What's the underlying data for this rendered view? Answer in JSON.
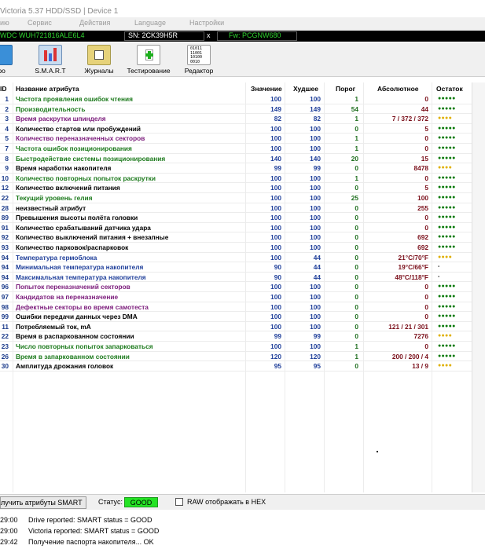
{
  "window": {
    "title": "Victoria 5.37 HDD/SSD | Device 1"
  },
  "menu": {
    "items": [
      "ию",
      "Сервис",
      "Действия",
      "Language",
      "Настройки"
    ]
  },
  "device": {
    "model": "WDC  WUH721816ALE6L4",
    "serial": "SN: 2CK39H5R",
    "close": "x",
    "firmware": "Fw: PCGNW680"
  },
  "toolbar": {
    "buttons": [
      {
        "label": "фо"
      },
      {
        "label": "S.M.A.R.T"
      },
      {
        "label": "Журналы"
      },
      {
        "label": "Тестирование"
      },
      {
        "label": "Редактор"
      }
    ]
  },
  "table": {
    "headers": {
      "id": "ID",
      "name": "Название атрибута",
      "value": "Значение",
      "worst": "Худшее",
      "threshold": "Порог",
      "raw": "Абсолютное",
      "remain": "Остаток"
    },
    "rows": [
      {
        "id": "1",
        "name": "Частота проявления ошибок чтения",
        "nc": "#1d7a1d",
        "v": "100",
        "w": "100",
        "t": "1",
        "a": "0",
        "r": "●●●●●",
        "rc": "#0a7a0a"
      },
      {
        "id": "2",
        "name": "Производительность",
        "nc": "#1d7a1d",
        "v": "149",
        "w": "149",
        "t": "54",
        "a": "44",
        "r": "●●●●●",
        "rc": "#0a7a0a"
      },
      {
        "id": "3",
        "name": "Время раскрутки шпинделя",
        "nc": "#7a1a7a",
        "v": "82",
        "w": "82",
        "t": "1",
        "a": "7 / 372 / 372",
        "r": "●●●●",
        "rc": "#e0b000"
      },
      {
        "id": "4",
        "name": "Количество стартов или пробуждений",
        "nc": "#000",
        "v": "100",
        "w": "100",
        "t": "0",
        "a": "5",
        "r": "●●●●●",
        "rc": "#0a7a0a"
      },
      {
        "id": "5",
        "name": "Количество переназначенных секторов",
        "nc": "#7a1a7a",
        "v": "100",
        "w": "100",
        "t": "1",
        "a": "0",
        "r": "●●●●●",
        "rc": "#0a7a0a"
      },
      {
        "id": "7",
        "name": "Частота ошибок позиционирования",
        "nc": "#1d7a1d",
        "v": "100",
        "w": "100",
        "t": "1",
        "a": "0",
        "r": "●●●●●",
        "rc": "#0a7a0a"
      },
      {
        "id": "8",
        "name": "Быстродействие системы позиционирования",
        "nc": "#1d7a1d",
        "v": "140",
        "w": "140",
        "t": "20",
        "a": "15",
        "r": "●●●●●",
        "rc": "#0a7a0a"
      },
      {
        "id": "9",
        "name": "Время наработки накопителя",
        "nc": "#000",
        "v": "99",
        "w": "99",
        "t": "0",
        "a": "8478",
        "r": "●●●●",
        "rc": "#e0b000"
      },
      {
        "id": "10",
        "name": "Количество повторных попыток раскрутки",
        "nc": "#1d7a1d",
        "v": "100",
        "w": "100",
        "t": "1",
        "a": "0",
        "r": "●●●●●",
        "rc": "#0a7a0a"
      },
      {
        "id": "12",
        "name": "Количество включений питания",
        "nc": "#000",
        "v": "100",
        "w": "100",
        "t": "0",
        "a": "5",
        "r": "●●●●●",
        "rc": "#0a7a0a"
      },
      {
        "id": "22",
        "name": "Текущий уровень гелия",
        "nc": "#1d7a1d",
        "v": "100",
        "w": "100",
        "t": "25",
        "a": "100",
        "r": "●●●●●",
        "rc": "#0a7a0a"
      },
      {
        "id": "28",
        "name": "неизвестный атрибут",
        "nc": "#000",
        "v": "100",
        "w": "100",
        "t": "0",
        "a": "255",
        "r": "●●●●●",
        "rc": "#0a7a0a"
      },
      {
        "id": "89",
        "name": "Превышения высоты полёта головки",
        "nc": "#000",
        "v": "100",
        "w": "100",
        "t": "0",
        "a": "0",
        "r": "●●●●●",
        "rc": "#0a7a0a"
      },
      {
        "id": "91",
        "name": "Количество срабатываний датчика удара",
        "nc": "#000",
        "v": "100",
        "w": "100",
        "t": "0",
        "a": "0",
        "r": "●●●●●",
        "rc": "#0a7a0a"
      },
      {
        "id": "92",
        "name": "Количество выключений питания + внезапные",
        "nc": "#000",
        "v": "100",
        "w": "100",
        "t": "0",
        "a": "692",
        "r": "●●●●●",
        "rc": "#0a7a0a"
      },
      {
        "id": "93",
        "name": "Количество парковок/распарковок",
        "nc": "#000",
        "v": "100",
        "w": "100",
        "t": "0",
        "a": "692",
        "r": "●●●●●",
        "rc": "#0a7a0a"
      },
      {
        "id": "94",
        "name": "Температура гермоблока",
        "nc": "#1f3f9a",
        "v": "100",
        "w": "44",
        "t": "0",
        "a": "21°C/70°F",
        "r": "●●●●",
        "rc": "#e0b000"
      },
      {
        "id": "94",
        "name": "Минимальная температура накопителя",
        "nc": "#1f3f9a",
        "v": "90",
        "w": "44",
        "t": "0",
        "a": "19°C/66°F",
        "r": "-",
        "rc": "#000"
      },
      {
        "id": "94",
        "name": "Максимальная температура накопителя",
        "nc": "#1f3f9a",
        "v": "90",
        "w": "44",
        "t": "0",
        "a": "48°C/118°F",
        "r": "-",
        "rc": "#000"
      },
      {
        "id": "96",
        "name": "Попыток переназначений секторов",
        "nc": "#7a1a7a",
        "v": "100",
        "w": "100",
        "t": "0",
        "a": "0",
        "r": "●●●●●",
        "rc": "#0a7a0a"
      },
      {
        "id": "97",
        "name": "Кандидатов на переназначение",
        "nc": "#7a1a7a",
        "v": "100",
        "w": "100",
        "t": "0",
        "a": "0",
        "r": "●●●●●",
        "rc": "#0a7a0a"
      },
      {
        "id": "98",
        "name": "Дефектные секторы во время самотеста",
        "nc": "#7a1a7a",
        "v": "100",
        "w": "100",
        "t": "0",
        "a": "0",
        "r": "●●●●●",
        "rc": "#0a7a0a"
      },
      {
        "id": "99",
        "name": "Ошибки передачи данных через DMA",
        "nc": "#000",
        "v": "100",
        "w": "100",
        "t": "0",
        "a": "0",
        "r": "●●●●●",
        "rc": "#0a7a0a"
      },
      {
        "id": "11",
        "name": "Потребляемый ток, mA",
        "nc": "#000",
        "v": "100",
        "w": "100",
        "t": "0",
        "a": "121 / 21 / 301",
        "r": "●●●●●",
        "rc": "#0a7a0a"
      },
      {
        "id": "22",
        "name": "Время в распаркованном состоянии",
        "nc": "#000",
        "v": "99",
        "w": "99",
        "t": "0",
        "a": "7276",
        "r": "●●●●",
        "rc": "#e0b000"
      },
      {
        "id": "23",
        "name": "Число повторных попыток запарковаться",
        "nc": "#1d7a1d",
        "v": "100",
        "w": "100",
        "t": "1",
        "a": "0",
        "r": "●●●●●",
        "rc": "#0a7a0a"
      },
      {
        "id": "26",
        "name": "Время в запаркованном состоянии",
        "nc": "#1d7a1d",
        "v": "120",
        "w": "120",
        "t": "1",
        "a": "200 / 200 / 4",
        "r": "●●●●●",
        "rc": "#0a7a0a"
      },
      {
        "id": "30",
        "name": "Амплитуда дрожания головок",
        "nc": "#000",
        "v": "95",
        "w": "95",
        "t": "0",
        "a": "13 / 9",
        "r": "●●●●",
        "rc": "#e0b000"
      }
    ]
  },
  "status": {
    "get_button": "лучить атрибуты SMART",
    "status_label": "Статус:",
    "status_value": "GOOD",
    "raw_hex_label": "RAW отображать в HEX"
  },
  "log": [
    {
      "time": "29:00",
      "msg": "Drive reported: SMART status = GOOD"
    },
    {
      "time": "29:00",
      "msg": "Victoria reported: SMART status = GOOD"
    },
    {
      "time": "29:42",
      "msg": "Получение паспорта накопителя... OK"
    }
  ]
}
